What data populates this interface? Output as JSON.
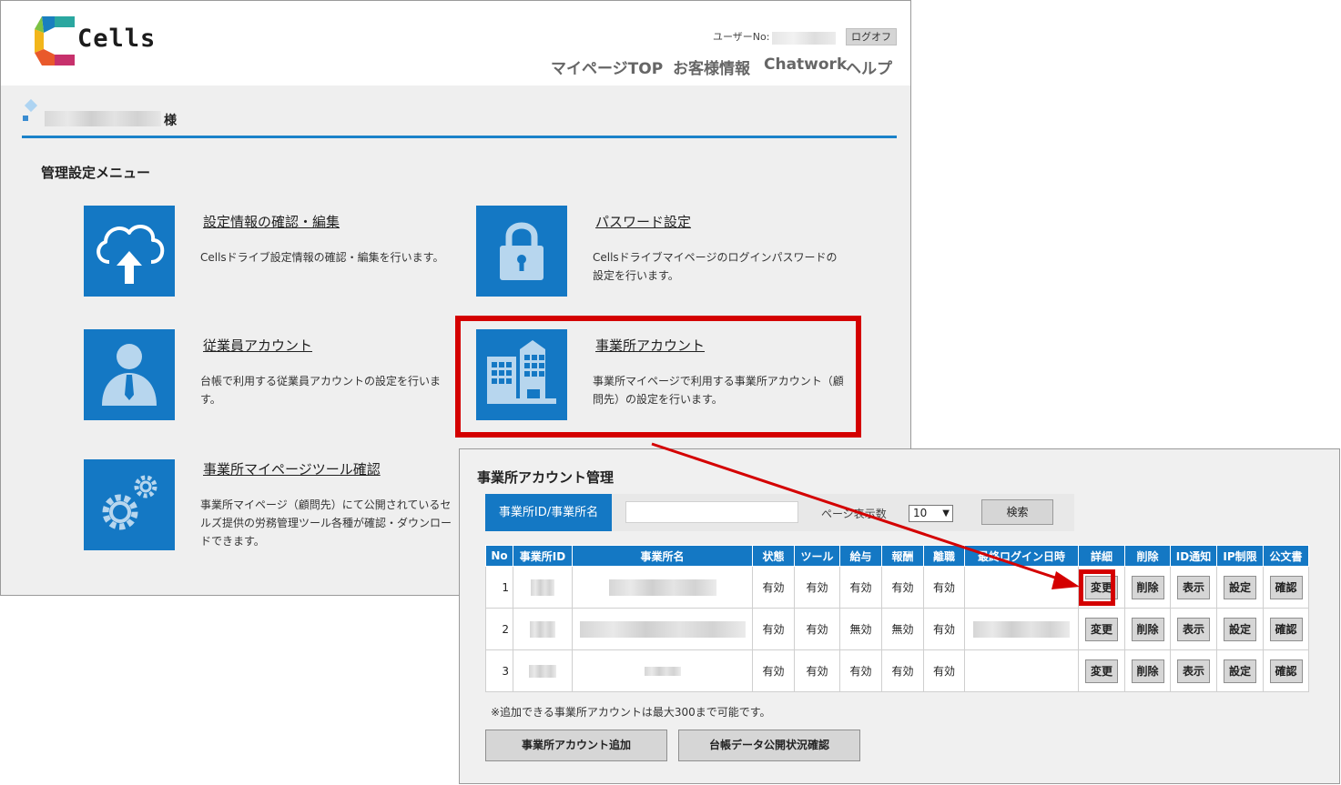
{
  "header": {
    "logo_text": "Cells",
    "user_no_label": "ユーザーNo:",
    "logoff_label": "ログオフ",
    "nav": [
      "マイページTOP",
      "お客様情報",
      "Chatwork",
      "ヘルプ"
    ]
  },
  "greeting": {
    "suffix": "様"
  },
  "menu": {
    "heading": "管理設定メニュー",
    "tiles": [
      {
        "title": "設定情報の確認・編集",
        "desc": "Cellsドライブ設定情報の確認・編集を行います。",
        "icon": "cloud-upload-icon"
      },
      {
        "title": "パスワード設定",
        "desc": "Cellsドライブマイページのログインパスワードの設定を行います。",
        "icon": "lock-icon"
      },
      {
        "title": "従業員アカウント",
        "desc": "台帳で利用する従業員アカウントの設定を行います。",
        "icon": "employee-icon"
      },
      {
        "title": "事業所アカウント",
        "desc": "事業所マイページで利用する事業所アカウント（顧問先）の設定を行います。",
        "icon": "building-icon"
      },
      {
        "title": "事業所マイページツール確認",
        "desc": "事業所マイページ（顧問先）にて公開されているセルズ提供の労務管理ツール各種が確認・ダウンロードできます。",
        "icon": "gears-icon"
      }
    ]
  },
  "sub": {
    "title": "事業所アカウント管理",
    "search_label": "事業所ID/事業所名",
    "search_value": "",
    "per_page_label": "ページ表示数",
    "per_page_value": "10",
    "search_button": "検索",
    "columns": [
      "No",
      "事業所ID",
      "事業所名",
      "状態",
      "ツール",
      "給与",
      "報酬",
      "離職",
      "最終ログイン日時",
      "詳細",
      "削除",
      "ID通知",
      "IP制限",
      "公文書"
    ],
    "rows": [
      {
        "no": "1",
        "status": "有効",
        "tool": "有効",
        "salary": "有効",
        "reward": "有効",
        "retire": "有効"
      },
      {
        "no": "2",
        "status": "有効",
        "tool": "有効",
        "salary": "無効",
        "reward": "無効",
        "retire": "有効"
      },
      {
        "no": "3",
        "status": "有効",
        "tool": "有効",
        "salary": "有効",
        "reward": "有効",
        "retire": "有効"
      }
    ],
    "row_buttons": [
      "変更",
      "削除",
      "表示",
      "設定",
      "確認"
    ],
    "note": "※追加できる事業所アカウントは最大300まで可能です。",
    "add_button": "事業所アカウント追加",
    "publish_button": "台帳データ公開状況確認"
  },
  "colors": {
    "accent": "#1478c4",
    "highlight": "#d40000"
  }
}
